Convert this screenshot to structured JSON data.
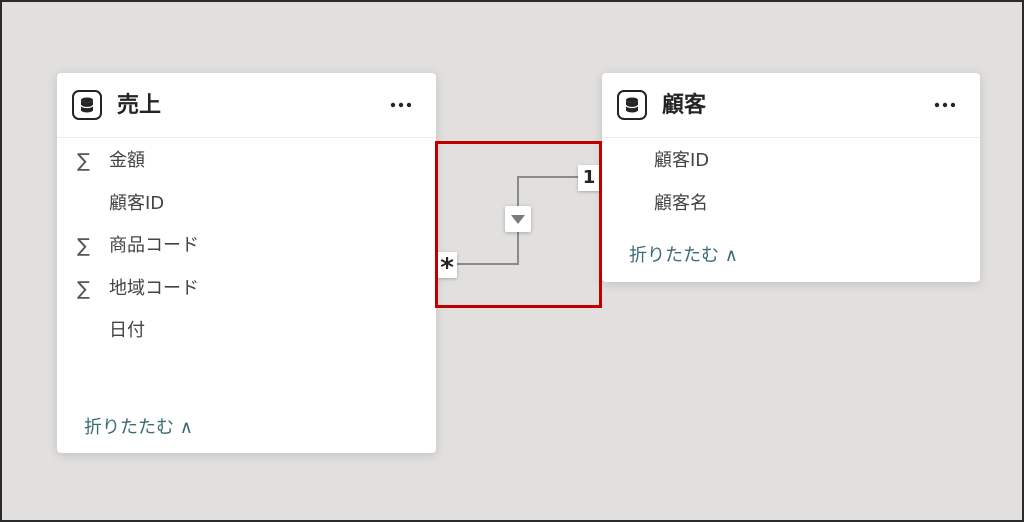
{
  "tables": {
    "sales": {
      "title": "売上",
      "icon": "database-icon",
      "fields": [
        {
          "name": "金額",
          "aggregate": true
        },
        {
          "name": "顧客ID",
          "aggregate": false
        },
        {
          "name": "商品コード",
          "aggregate": true
        },
        {
          "name": "地域コード",
          "aggregate": true
        },
        {
          "name": "日付",
          "aggregate": false
        }
      ],
      "collapse_label": "折りたたむ ∧",
      "more_icon": "more-options-icon"
    },
    "customer": {
      "title": "顧客",
      "icon": "database-icon",
      "fields": [
        {
          "name": "顧客ID",
          "aggregate": false
        },
        {
          "name": "顧客名",
          "aggregate": false
        }
      ],
      "collapse_label": "折りたたむ ∧",
      "more_icon": "more-options-icon"
    }
  },
  "relationship": {
    "from_table": "売上",
    "to_table": "顧客",
    "many_marker": "*",
    "one_marker": "1",
    "filter_icon": "filter-direction-icon",
    "sigma_glyph": "∑",
    "colors": {
      "highlight": "#c00000",
      "line": "#8a8a8a",
      "link": "#3b6b74",
      "canvas": "#e1e0de"
    }
  }
}
